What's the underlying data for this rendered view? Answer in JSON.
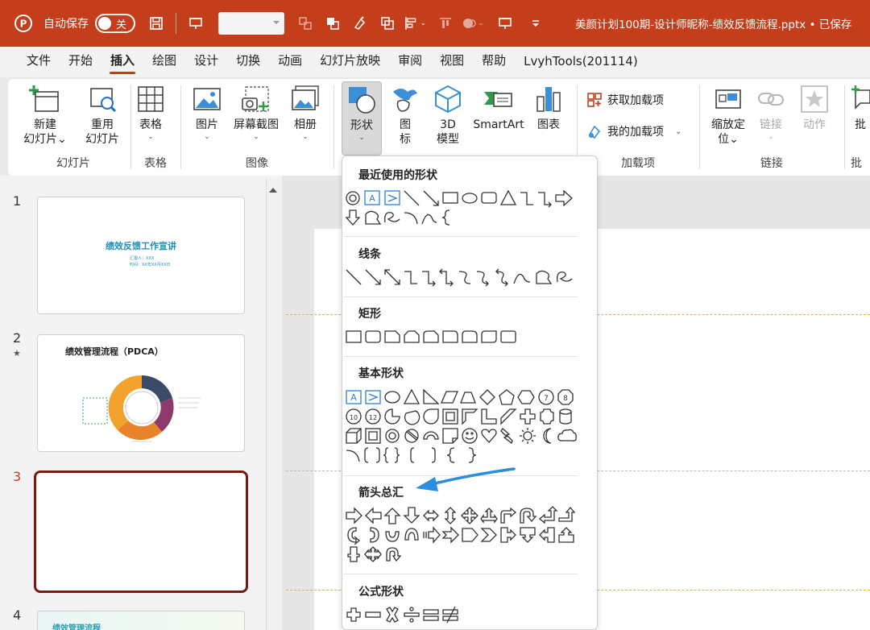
{
  "titlebar": {
    "autosave_label": "自动保存",
    "autosave_state": "关",
    "document_title": "美颜计划100期-设计师昵称-绩效反馈流程.pptx • 已保存"
  },
  "tabs": [
    "文件",
    "开始",
    "插入",
    "绘图",
    "设计",
    "切换",
    "动画",
    "幻灯片放映",
    "审阅",
    "视图",
    "帮助",
    "LvyhTools(201114)"
  ],
  "active_tab": "插入",
  "ribbon": {
    "groups": {
      "slides": "幻灯片",
      "tables": "表格",
      "images": "图像",
      "addins": "加载项",
      "links": "链接",
      "partial": "批"
    },
    "buttons": {
      "new_slide": "新建\n幻灯片⌄",
      "reuse_slide": "重用\n幻灯片",
      "table": "表格",
      "picture": "图片",
      "screenshot": "屏幕截图",
      "album": "相册",
      "shapes": "形状",
      "icons": "图\n标",
      "model3d": "3D\n模型",
      "smartart": "SmartArt",
      "chart": "图表",
      "get_addins": "获取加载项",
      "my_addins": "我的加载项",
      "zoom": "缩放定\n位⌄",
      "link": "链接",
      "action": "动作",
      "comment_partial": "批"
    }
  },
  "slides": [
    {
      "num": "1",
      "title": "绩效反馈工作宣讲",
      "sub1": "汇报人：XXX",
      "sub2": "时间：XX年XX月XX日"
    },
    {
      "num": "2",
      "mark": "★",
      "title": "绩效管理流程（PDCA）"
    },
    {
      "num": "3"
    },
    {
      "num": "4",
      "title": "绩效管理流程"
    }
  ],
  "shapes_menu": {
    "sections": [
      "最近使用的形状",
      "线条",
      "矩形",
      "基本形状",
      "箭头总汇",
      "公式形状"
    ]
  },
  "colors": {
    "accent": "#c43e1c",
    "current_slide_border": "#7a1a14",
    "annotation_arrow": "#2b8ce0"
  }
}
